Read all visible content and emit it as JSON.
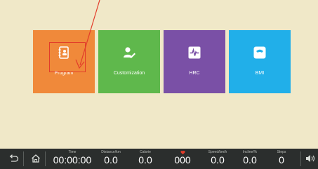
{
  "tiles": [
    {
      "label": "Program",
      "icon": "notebook-icon",
      "color": "#f0893a"
    },
    {
      "label": "Customization",
      "icon": "user-edit-icon",
      "color": "#5fb84c"
    },
    {
      "label": "HRC",
      "icon": "heart-rate-monitor-icon",
      "color": "#7a50a6"
    },
    {
      "label": "BMI",
      "icon": "scale-icon",
      "color": "#21afe9"
    }
  ],
  "status_bar": {
    "time": {
      "label": "Time",
      "value": "00:00:00"
    },
    "distance": {
      "label": "Distance/km",
      "value": "0.0"
    },
    "calorie": {
      "label": "Calorie",
      "value": "0.0"
    },
    "heart_rate": {
      "icon": "heart-icon",
      "value": "000"
    },
    "speed": {
      "label": "Speed/km/h",
      "value": "0.0"
    },
    "incline": {
      "label": "Incline/%",
      "value": "0.0"
    },
    "steps": {
      "label": "Steps",
      "value": "0"
    }
  },
  "colors": {
    "annotation": "#e23c2a",
    "background": "#f0e8c8",
    "status_bar": "#2b2e2d"
  }
}
